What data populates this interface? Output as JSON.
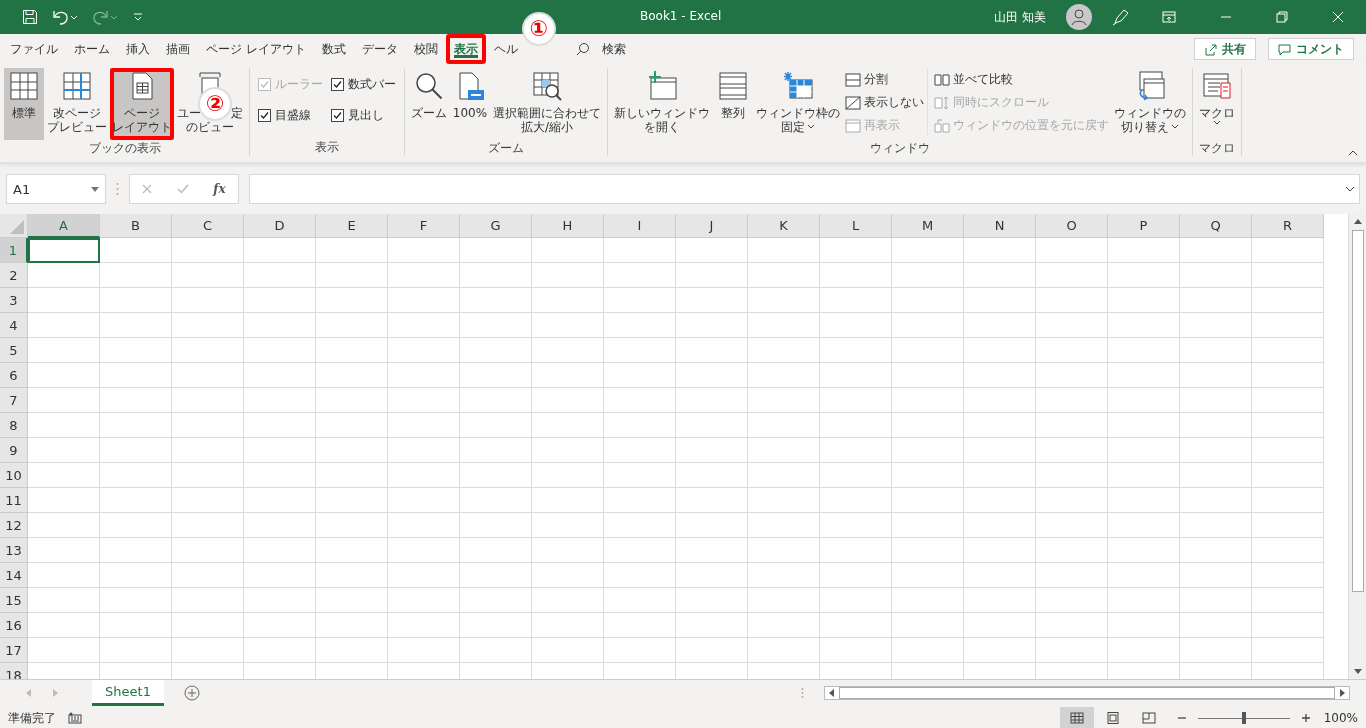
{
  "title_bar": {
    "title": "Book1  -  Excel",
    "user": "山田 知美"
  },
  "tabs": [
    {
      "label": "ファイル",
      "selected": false,
      "highlighted": false
    },
    {
      "label": "ホーム",
      "selected": false,
      "highlighted": false
    },
    {
      "label": "挿入",
      "selected": false,
      "highlighted": false
    },
    {
      "label": "描画",
      "selected": false,
      "highlighted": false
    },
    {
      "label": "ページ レイアウト",
      "selected": false,
      "highlighted": false
    },
    {
      "label": "数式",
      "selected": false,
      "highlighted": false
    },
    {
      "label": "データ",
      "selected": false,
      "highlighted": false
    },
    {
      "label": "校閲",
      "selected": false,
      "highlighted": false
    },
    {
      "label": "表示",
      "selected": true,
      "highlighted": true
    },
    {
      "label": "ヘル",
      "selected": false,
      "highlighted": false,
      "callout": "①"
    }
  ],
  "search": {
    "label": "検索"
  },
  "share_button": "共有",
  "comment_button": "コメント",
  "ribbon": [
    {
      "label": "ブックの表示",
      "items": [
        {
          "kind": "large",
          "lines": [
            "標準"
          ],
          "selected": true,
          "highlighted": false
        },
        {
          "kind": "large",
          "lines": [
            "改ページ",
            "プレビュー"
          ],
          "selected": false,
          "highlighted": false
        },
        {
          "kind": "large",
          "lines": [
            "ページ",
            "レイアウト"
          ],
          "selected": true,
          "highlighted": true
        },
        {
          "kind": "large",
          "lines": [
            "ユー",
            "のビュー"
          ],
          "line_tail": "定",
          "callout": "②",
          "selected": false,
          "highlighted": false
        }
      ]
    },
    {
      "label": "表示",
      "items": [
        {
          "kind": "checks",
          "checks": [
            {
              "label": "ルーラー",
              "checked": true,
              "disabled": true
            },
            {
              "label": "数式バー",
              "checked": true,
              "disabled": false
            },
            {
              "label": "目盛線",
              "checked": true,
              "disabled": false
            },
            {
              "label": "見出し",
              "checked": true,
              "disabled": false
            }
          ]
        }
      ]
    },
    {
      "label": "ズーム",
      "items": [
        {
          "kind": "large",
          "lines": [
            "ズーム"
          ],
          "selected": false,
          "highlighted": false
        },
        {
          "kind": "large",
          "lines": [
            "100%"
          ],
          "selected": false,
          "highlighted": false
        },
        {
          "kind": "large",
          "lines": [
            "選択範囲に合わせて",
            "拡大/縮小"
          ],
          "selected": false,
          "highlighted": false
        }
      ]
    },
    {
      "label": "ウィンドウ",
      "items": [
        {
          "kind": "large",
          "lines": [
            "新しいウィンドウ",
            "を開く"
          ],
          "selected": false,
          "highlighted": false
        },
        {
          "kind": "large",
          "lines": [
            "整列"
          ],
          "selected": false,
          "highlighted": false
        },
        {
          "kind": "large",
          "lines": [
            "ウィンドウ枠の",
            "固定"
          ],
          "dropdown": true,
          "selected": false,
          "highlighted": false
        },
        {
          "kind": "smalls",
          "smalls": [
            {
              "label": "分割",
              "disabled": false
            },
            {
              "label": "表示しない",
              "disabled": false
            },
            {
              "label": "再表示",
              "disabled": true
            }
          ]
        },
        {
          "kind": "smalls",
          "smalls": [
            {
              "label": "並べて比較",
              "disabled": false
            },
            {
              "label": "同時にスクロール",
              "disabled": true
            },
            {
              "label": "ウィンドウの位置を元に戻す",
              "disabled": true
            }
          ]
        },
        {
          "kind": "large",
          "lines": [
            "ウィンドウの",
            "切り替え"
          ],
          "dropdown": true,
          "selected": false,
          "highlighted": false
        }
      ]
    },
    {
      "label": "マクロ",
      "items": [
        {
          "kind": "large",
          "lines": [
            "マクロ"
          ],
          "dropdown": true,
          "dropdown_below": true,
          "selected": false,
          "highlighted": false
        }
      ]
    }
  ],
  "formula_bar": {
    "name_box": "A1",
    "function_button": "fx"
  },
  "columns": [
    {
      "label": "A",
      "selected": true
    },
    {
      "label": "B",
      "selected": false
    },
    {
      "label": "C",
      "selected": false
    },
    {
      "label": "D",
      "selected": false
    },
    {
      "label": "E",
      "selected": false
    },
    {
      "label": "F",
      "selected": false
    },
    {
      "label": "G",
      "selected": false
    },
    {
      "label": "H",
      "selected": false
    },
    {
      "label": "I",
      "selected": false
    },
    {
      "label": "J",
      "selected": false
    },
    {
      "label": "K",
      "selected": false
    },
    {
      "label": "L",
      "selected": false
    },
    {
      "label": "M",
      "selected": false
    },
    {
      "label": "N",
      "selected": false
    },
    {
      "label": "O",
      "selected": false
    },
    {
      "label": "P",
      "selected": false
    },
    {
      "label": "Q",
      "selected": false
    },
    {
      "label": "R",
      "selected": false
    }
  ],
  "rows": [
    {
      "label": "1",
      "selected": true
    },
    {
      "label": "2",
      "selected": false
    },
    {
      "label": "3",
      "selected": false
    },
    {
      "label": "4",
      "selected": false
    },
    {
      "label": "5",
      "selected": false
    },
    {
      "label": "6",
      "selected": false
    },
    {
      "label": "7",
      "selected": false
    },
    {
      "label": "8",
      "selected": false
    },
    {
      "label": "9",
      "selected": false
    },
    {
      "label": "10",
      "selected": false
    },
    {
      "label": "11",
      "selected": false
    },
    {
      "label": "12",
      "selected": false
    },
    {
      "label": "13",
      "selected": false
    },
    {
      "label": "14",
      "selected": false
    },
    {
      "label": "15",
      "selected": false
    },
    {
      "label": "16",
      "selected": false
    },
    {
      "label": "17",
      "selected": false
    },
    {
      "label": "18",
      "selected": false
    }
  ],
  "sheet_tabs": [
    {
      "label": "Sheet1",
      "selected": true
    }
  ],
  "status_bar": {
    "status": "準備完了",
    "views": [
      {
        "selected": true
      },
      {
        "selected": false
      },
      {
        "selected": false
      }
    ],
    "zoom": {
      "level": 0.5,
      "reading": "100%"
    }
  }
}
